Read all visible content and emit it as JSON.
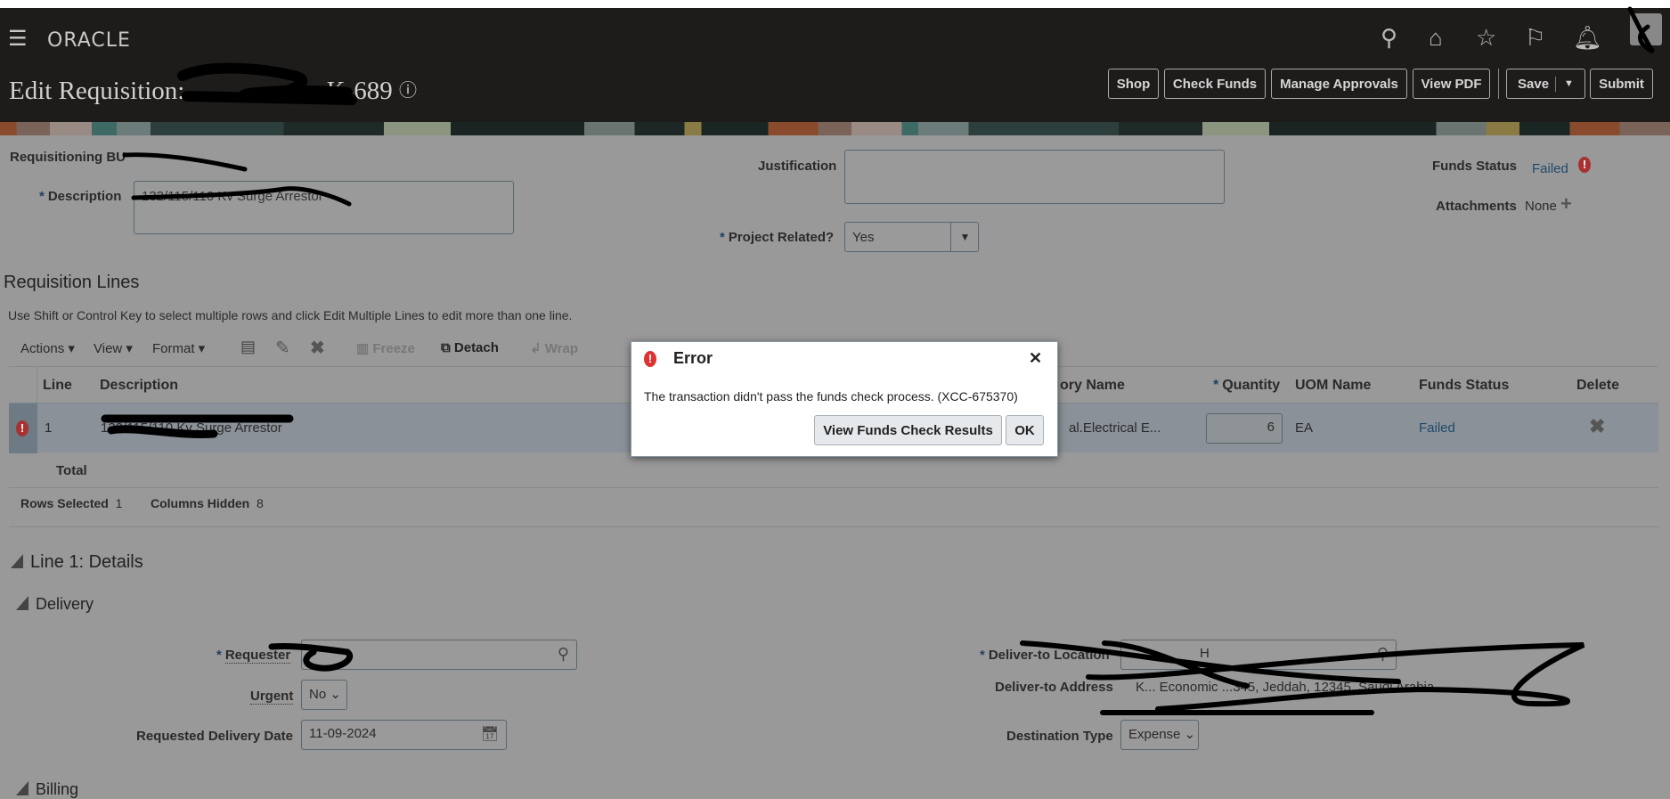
{
  "header": {
    "logo": "ORACLE",
    "title_prefix": "Edit Requisition:",
    "title_suffix": "K-689",
    "buttons": {
      "shop": "Shop",
      "check_funds": "Check Funds",
      "manage_approvals": "Manage Approvals",
      "view_pdf": "View PDF",
      "save": "Save",
      "submit": "Submit"
    }
  },
  "form": {
    "requisitioning_bu_label": "Requisitioning BU",
    "description_label": "Description",
    "description_value": "132/115/110 Kv Surge Arrestor",
    "justification_label": "Justification",
    "justification_value": "",
    "project_related_label": "Project Related?",
    "project_related_value": "Yes",
    "funds_status_label": "Funds Status",
    "funds_status_value": "Failed",
    "attachments_label": "Attachments",
    "attachments_value": "None"
  },
  "lines": {
    "title": "Requisition Lines",
    "hint": "Use Shift or Control Key to select multiple rows and click Edit Multiple Lines to edit more than one line.",
    "toolbar": {
      "actions": "Actions",
      "view": "View",
      "format": "Format",
      "freeze": "Freeze",
      "detach": "Detach",
      "wrap": "Wrap"
    },
    "columns": {
      "line": "Line",
      "description": "Description",
      "category": "ory Name",
      "quantity": "Quantity",
      "uom": "UOM Name",
      "funds_status": "Funds Status",
      "delete": "Delete"
    },
    "rows": [
      {
        "line": "1",
        "description": "132/115/110 Kv Surge Arrestor",
        "category": "al.Electrical E...",
        "quantity": "6",
        "uom": "EA",
        "funds_status": "Failed"
      }
    ],
    "total_label": "Total",
    "rows_selected_label": "Rows Selected",
    "rows_selected_value": "1",
    "columns_hidden_label": "Columns Hidden",
    "columns_hidden_value": "8"
  },
  "details": {
    "title": "Line 1: Details",
    "delivery_title": "Delivery",
    "requester_label": "Requester",
    "urgent_label": "Urgent",
    "urgent_value": "No",
    "requested_date_label": "Requested Delivery Date",
    "requested_date_value": "11-09-2024",
    "deliver_location_label": "Deliver-to Location",
    "deliver_location_value": "H",
    "deliver_address_label": "Deliver-to Address",
    "deliver_address_value": "K... Economic ...345, Jeddah, 12345, Saudi Arabia",
    "destination_type_label": "Destination Type",
    "destination_type_value": "Expense",
    "billing_title": "Billing"
  },
  "dialog": {
    "title": "Error",
    "message": "The transaction didn't pass the funds check process. (XCC-675370)",
    "view_results_button": "View Funds Check Results",
    "ok_button": "OK"
  }
}
